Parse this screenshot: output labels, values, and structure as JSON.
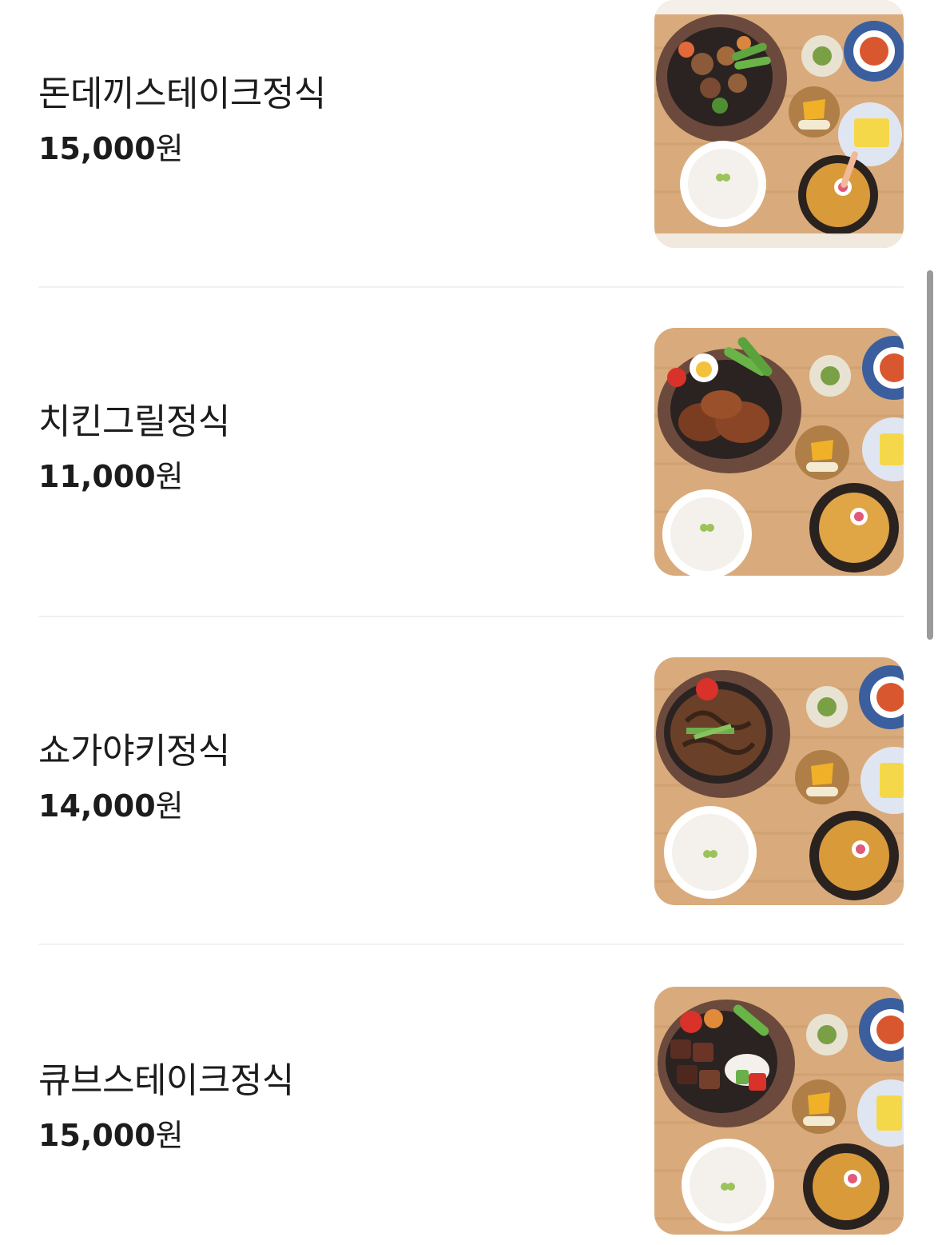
{
  "menu": {
    "items": [
      {
        "name": "돈데끼스테이크정식",
        "price_number": "15,000",
        "price_unit": "원",
        "image_icon": "food-photo-icon"
      },
      {
        "name": "치킨그릴정식",
        "price_number": "11,000",
        "price_unit": "원",
        "image_icon": "food-photo-icon"
      },
      {
        "name": "쇼가야키정식",
        "price_number": "14,000",
        "price_unit": "원",
        "image_icon": "food-photo-icon"
      },
      {
        "name": "큐브스테이크정식",
        "price_number": "15,000",
        "price_unit": "원",
        "image_icon": "food-photo-icon"
      }
    ]
  },
  "scroll": {
    "position": 0.3
  },
  "colors": {
    "text": "#1c1c1c",
    "divider": "#f1f1f1",
    "scrollbar": "#9a9a9a",
    "wood": "#d8a979"
  }
}
